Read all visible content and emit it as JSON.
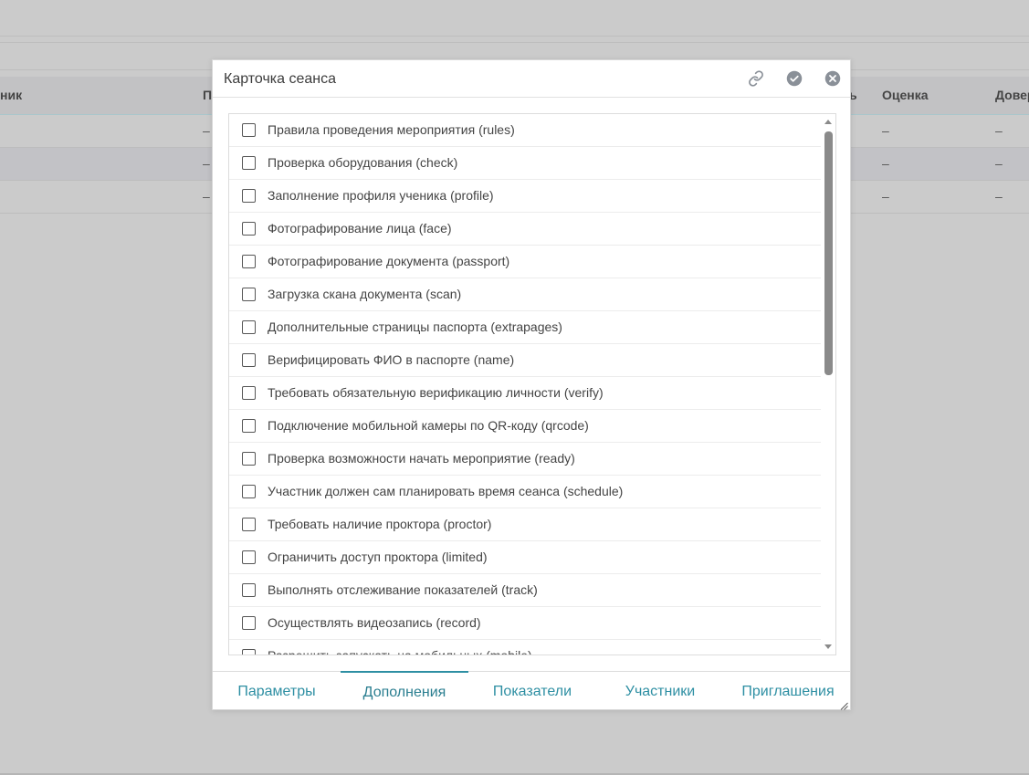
{
  "background": {
    "columns": [
      {
        "label": "ник"
      },
      {
        "label": "П"
      },
      {
        "label": "ь"
      },
      {
        "label": "Оценка"
      },
      {
        "label": "Довер"
      }
    ],
    "rows": [
      {
        "c1": "–",
        "c2": "–",
        "c3": "–"
      },
      {
        "c1": "–",
        "c2": "–",
        "c3": "–"
      },
      {
        "c1": "–",
        "c2": "–",
        "c3": "–"
      }
    ]
  },
  "dialog": {
    "title": "Карточка сеанса",
    "icons": {
      "link": "link-icon",
      "confirm": "check-circle-icon",
      "close": "close-circle-icon"
    },
    "options": [
      {
        "label": "Правила проведения мероприятия (rules)",
        "checked": false
      },
      {
        "label": "Проверка оборудования (check)",
        "checked": false
      },
      {
        "label": "Заполнение профиля ученика (profile)",
        "checked": false
      },
      {
        "label": "Фотографирование лица (face)",
        "checked": false
      },
      {
        "label": "Фотографирование документа (passport)",
        "checked": false
      },
      {
        "label": "Загрузка скана документа (scan)",
        "checked": false
      },
      {
        "label": "Дополнительные страницы паспорта (extrapages)",
        "checked": false
      },
      {
        "label": "Верифицировать ФИО в паспорте (name)",
        "checked": false
      },
      {
        "label": "Требовать обязательную верификацию личности (verify)",
        "checked": false
      },
      {
        "label": "Подключение мобильной камеры по QR-коду (qrcode)",
        "checked": false
      },
      {
        "label": "Проверка возможности начать мероприятие (ready)",
        "checked": false
      },
      {
        "label": "Участник должен сам планировать время сеанса (schedule)",
        "checked": false
      },
      {
        "label": "Требовать наличие проктора (proctor)",
        "checked": false
      },
      {
        "label": "Ограничить доступ проктора (limited)",
        "checked": false
      },
      {
        "label": "Выполнять отслеживание показателей (track)",
        "checked": false
      },
      {
        "label": "Осуществлять видеозапись (record)",
        "checked": false
      },
      {
        "label": "Разрешить запускать на мобильных (mobile)",
        "checked": false
      }
    ],
    "tabs": [
      {
        "label": "Параметры"
      },
      {
        "label": "Дополнения"
      },
      {
        "label": "Показатели"
      },
      {
        "label": "Участники"
      },
      {
        "label": "Приглашения"
      }
    ],
    "active_tab": "Дополнения",
    "colors": {
      "accent": "#2e8fa3",
      "icon": "#8a9098"
    }
  }
}
